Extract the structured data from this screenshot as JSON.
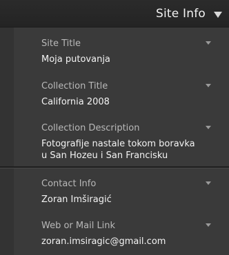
{
  "panel": {
    "title": "Site Info"
  },
  "fields": [
    {
      "label": "Site Title",
      "value": "Moja putovanja"
    },
    {
      "label": "Collection Title",
      "value": "California 2008"
    },
    {
      "label": "Collection Description",
      "value_lines": [
        "Fotografije nastale tokom boravka",
        "u San Hozeu i San Francisku"
      ]
    },
    {
      "label": "Contact Info",
      "value": "Zoran Imširagić"
    },
    {
      "label": "Web or Mail Link",
      "value": "zoran.imsiragic@gmail.com"
    }
  ],
  "icons": {
    "header": "collapse-triangle-icon",
    "field_menu": "dropdown-arrow-icon"
  },
  "colors": {
    "panel_bg": "#3a3a3a",
    "header_bg": "#262626",
    "label": "#b9b9b9",
    "value": "#f4f4f4"
  }
}
